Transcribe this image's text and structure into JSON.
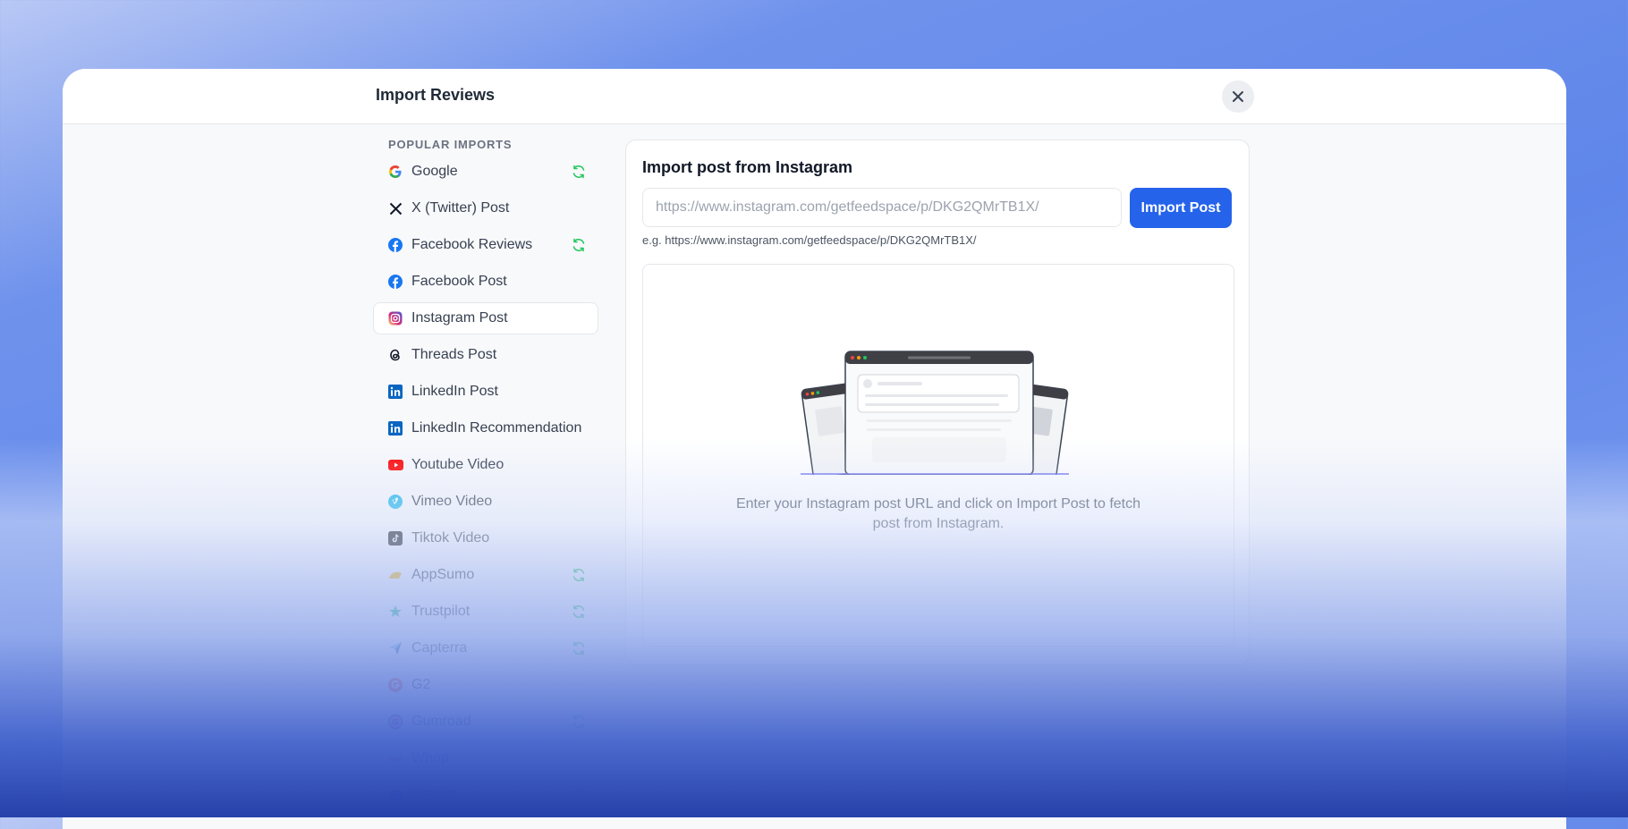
{
  "modal": {
    "title": "Import Reviews",
    "close_icon": "close-icon"
  },
  "sidebar": {
    "heading": "POPULAR IMPORTS",
    "items": [
      {
        "label": "Google",
        "icon": "google-icon",
        "sync": true
      },
      {
        "label": "X (Twitter) Post",
        "icon": "x-twitter-icon",
        "sync": false
      },
      {
        "label": "Facebook Reviews",
        "icon": "facebook-icon",
        "sync": true
      },
      {
        "label": "Facebook Post",
        "icon": "facebook-icon",
        "sync": false
      },
      {
        "label": "Instagram Post",
        "icon": "instagram-icon",
        "sync": false,
        "active": true
      },
      {
        "label": "Threads Post",
        "icon": "threads-icon",
        "sync": false
      },
      {
        "label": "LinkedIn Post",
        "icon": "linkedin-icon",
        "sync": false
      },
      {
        "label": "LinkedIn Recommendation",
        "icon": "linkedin-icon",
        "sync": false
      },
      {
        "label": "Youtube Video",
        "icon": "youtube-icon",
        "sync": false
      },
      {
        "label": "Vimeo Video",
        "icon": "vimeo-icon",
        "sync": false
      },
      {
        "label": "Tiktok Video",
        "icon": "tiktok-icon",
        "sync": false
      },
      {
        "label": "AppSumo",
        "icon": "appsumo-icon",
        "sync": true
      },
      {
        "label": "Trustpilot",
        "icon": "trustpilot-icon",
        "sync": true
      },
      {
        "label": "Capterra",
        "icon": "capterra-icon",
        "sync": true
      },
      {
        "label": "G2",
        "icon": "g2-icon",
        "sync": false
      },
      {
        "label": "Gumroad",
        "icon": "gumroad-icon",
        "sync": true
      },
      {
        "label": "Whop",
        "icon": "whop-icon",
        "sync": false
      },
      {
        "label": "Fresha",
        "icon": "fresha-icon",
        "sync": true
      }
    ]
  },
  "panel": {
    "title": "Import post from Instagram",
    "url_placeholder": "https://www.instagram.com/getfeedspace/p/DKG2QMrTB1X/",
    "url_value": "",
    "import_button": "Import Post",
    "hint": "e.g. https://www.instagram.com/getfeedspace/p/DKG2QMrTB1X/",
    "empty_message": "Enter your Instagram post URL and click on Import Post to fetch post from Instagram."
  },
  "colors": {
    "accent": "#2563eb",
    "sync_icon": "#22c55e",
    "background_top": "#5f86ea",
    "background_bottom": "#2642aa"
  }
}
